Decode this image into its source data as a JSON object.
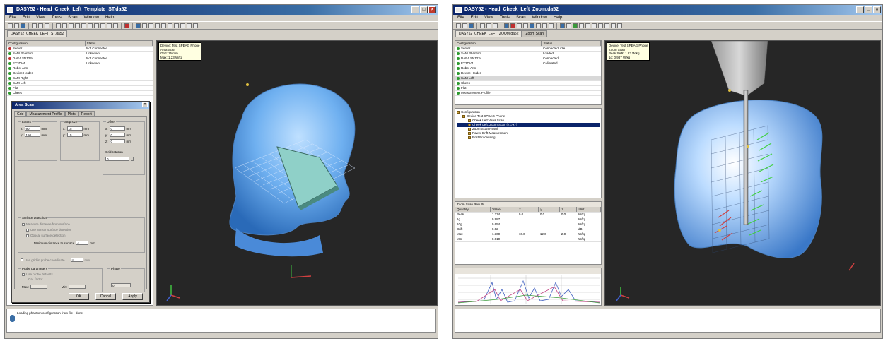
{
  "left_window": {
    "title": "DASY52 - Head_Cheek_Left_Template_ST.da52",
    "menu": [
      "File",
      "Edit",
      "View",
      "Tools",
      "Scan",
      "Window",
      "Help"
    ],
    "doc_tab": "DASY52_CHEEK_LEFT_ST.da52",
    "tree_headers": [
      "Configuration",
      "Status"
    ],
    "tree_rows": [
      {
        "name": "Server",
        "status": "Not Connected"
      },
      {
        "name": "SAM Phantom",
        "status": "Unknown"
      },
      {
        "name": "DAE4 SN1234",
        "status": "Not Connected"
      },
      {
        "name": "EX3DV4",
        "status": "Unknown"
      },
      {
        "name": "Robot Arm",
        "status": ""
      },
      {
        "name": "Device Holder",
        "status": ""
      },
      {
        "name": "SAM Right",
        "status": ""
      },
      {
        "name": "SAM Left",
        "status": ""
      },
      {
        "name": "Flat",
        "status": ""
      },
      {
        "name": "Cheek",
        "status": ""
      }
    ],
    "tooltip": [
      "Device: Test SPEAG Phone",
      "Area Scan",
      "Grid: 15 mm",
      "Max: 1.23 W/kg"
    ],
    "dialog": {
      "title": "Area Scan",
      "tabs": [
        "Grid",
        "Measurement Profile",
        "Plots",
        "Report"
      ],
      "group_extent": "Extent",
      "group_step": "Step size",
      "group_offset": "Offset",
      "extent_x": "90",
      "extent_y": "150",
      "step_x": "15",
      "step_y": "15",
      "offset_x": "0",
      "offset_y": "0",
      "offset_z": "0",
      "mm": "mm",
      "rotation_label": "Grid rotation",
      "rotation_value": "0",
      "group_surface": "Surface detection",
      "surface_opt1": "Measure distance from surface",
      "surface_opt2": "Use sensor surface detection",
      "surface_opt3": "Optical surface detection",
      "min_distance_label": "Minimum distance to surface",
      "min_distance_value": "4",
      "ruler_label": "Use grid in probe coordinate",
      "ruler_value": "8",
      "group_probe": "Probe parameters",
      "probe_opt": "Use probe defaults",
      "probe_sub": "Cal. factor",
      "max_label": "Max:",
      "min_label": "Min:",
      "max_value": "",
      "min_value": "",
      "group_phase": "Phase",
      "phase_value": "0",
      "ok": "OK",
      "cancel": "Cancel",
      "apply": "Apply"
    },
    "log_line": "Loading phantom configuration from file - done"
  },
  "right_window": {
    "title": "DASY52 - Head_Cheek_Left_Zoom.da52",
    "menu": [
      "File",
      "Edit",
      "View",
      "Tools",
      "Scan",
      "Window",
      "Help"
    ],
    "doc_tab": "DASY52_CHEEK_LEFT_ZOOM.da52",
    "doc_tab2": "Zoom Scan",
    "tree_headers": [
      "Configuration",
      "Status"
    ],
    "tree_rows": [
      {
        "name": "Server",
        "status": "Connected, idle"
      },
      {
        "name": "SAM Phantom",
        "status": "Loaded"
      },
      {
        "name": "DAE4 SN1234",
        "status": "Connected"
      },
      {
        "name": "EX3DV4",
        "status": "Calibrated"
      },
      {
        "name": "Robot Arm",
        "status": ""
      },
      {
        "name": "Device Holder",
        "status": ""
      },
      {
        "name": "SAM Left",
        "status": ""
      },
      {
        "name": "Cheek",
        "status": ""
      },
      {
        "name": "Flat",
        "status": ""
      },
      {
        "name": "Measurement Profile",
        "status": ""
      }
    ],
    "scan_tree": [
      "Configuration",
      "Device Test SPEAG Phone",
      "Cheek Left: Area Scan",
      "Cheek Left: Zoom Scan (7x7x7)",
      "Zoom Scan Result",
      "Power Drift Measurement",
      "Post Processing"
    ],
    "results_title": "Zoom Scan Results",
    "results_headers": [
      "Quantity",
      "Value",
      "x",
      "y",
      "z",
      "Unit"
    ],
    "results_rows": [
      [
        "Peak",
        "1.234",
        "0.0",
        "0.0",
        "0.0",
        "W/kg"
      ],
      [
        "1g",
        "0.987",
        "",
        "",
        "",
        "W/kg"
      ],
      [
        "10g",
        "0.654",
        "",
        "",
        "",
        "W/kg"
      ],
      [
        "Drift",
        "0.02",
        "",
        "",
        "",
        "dB"
      ],
      [
        "Max",
        "1.300",
        "10.0",
        "12.0",
        "2.0",
        "W/kg"
      ],
      [
        "Min",
        "0.010",
        "",
        "",
        "",
        "W/kg"
      ]
    ],
    "tooltip": [
      "Device: Test SPEAG Phone",
      "Zoom Scan",
      "Peak SAR: 1.23 W/kg",
      "1g: 0.987 W/kg"
    ]
  }
}
